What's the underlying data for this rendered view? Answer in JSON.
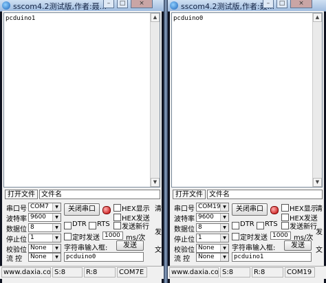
{
  "left": {
    "title": "sscom4.2测试版,作者:聂...",
    "controls": {
      "min": "–",
      "max": "□",
      "close": "×"
    },
    "receive_text": "pcduino1",
    "file_button": "打开文件",
    "file_name_label": "文件名",
    "labels": {
      "port": "串口号",
      "baud": "波特率",
      "databits": "数据位",
      "stopbits": "停止位",
      "parity": "校验位",
      "flow": "流 控"
    },
    "values": {
      "port": "COM7",
      "baud": "9600",
      "databits": "8",
      "stopbits": "1",
      "parity": "None",
      "flow": "None"
    },
    "close_port_button": "关闭串口",
    "hex_display": "HEX显示",
    "hex_send": "HEX发送",
    "dtr": "DTR",
    "rts": "RTS",
    "send_newline": "发送新行",
    "timed_send": "定时发送",
    "interval": "1000",
    "interval_unit": "ms/次",
    "string_input_label": "字符串输入框:",
    "send_button": "发送",
    "send_text": "pcduino0",
    "right_edge_chars": [
      "清",
      "发",
      "文"
    ],
    "status": {
      "website": "www.daxia.cor",
      "sent": "S:8",
      "received": "R:8",
      "port": "COM7E"
    }
  },
  "right": {
    "title": "sscom4.2测试版,作者:聂...",
    "controls": {
      "min": "–",
      "max": "□",
      "close": "×"
    },
    "receive_text": "pcduino0",
    "file_button": "打开文件",
    "file_name_label": "文件名",
    "labels": {
      "port": "串口号",
      "baud": "波特率",
      "databits": "数据位",
      "stopbits": "停止位",
      "parity": "校验位",
      "flow": "流 控"
    },
    "values": {
      "port": "COM19",
      "baud": "9600",
      "databits": "8",
      "stopbits": "1",
      "parity": "None",
      "flow": "None"
    },
    "close_port_button": "关闭串口",
    "hex_display": "HEX显示",
    "hex_send": "HEX发送",
    "dtr": "DTR",
    "rts": "RTS",
    "send_newline": "发送新行",
    "timed_send": "定时发送",
    "interval": "1000",
    "interval_unit": "ms/次",
    "string_input_label": "字符串输入框:",
    "send_button": "发送",
    "send_text": "pcduino1",
    "right_edge_chars": [
      "清",
      "发",
      "文"
    ],
    "status": {
      "website": "www.daxia.com",
      "sent": "S:8",
      "received": "R:8",
      "port": "COM19"
    }
  }
}
